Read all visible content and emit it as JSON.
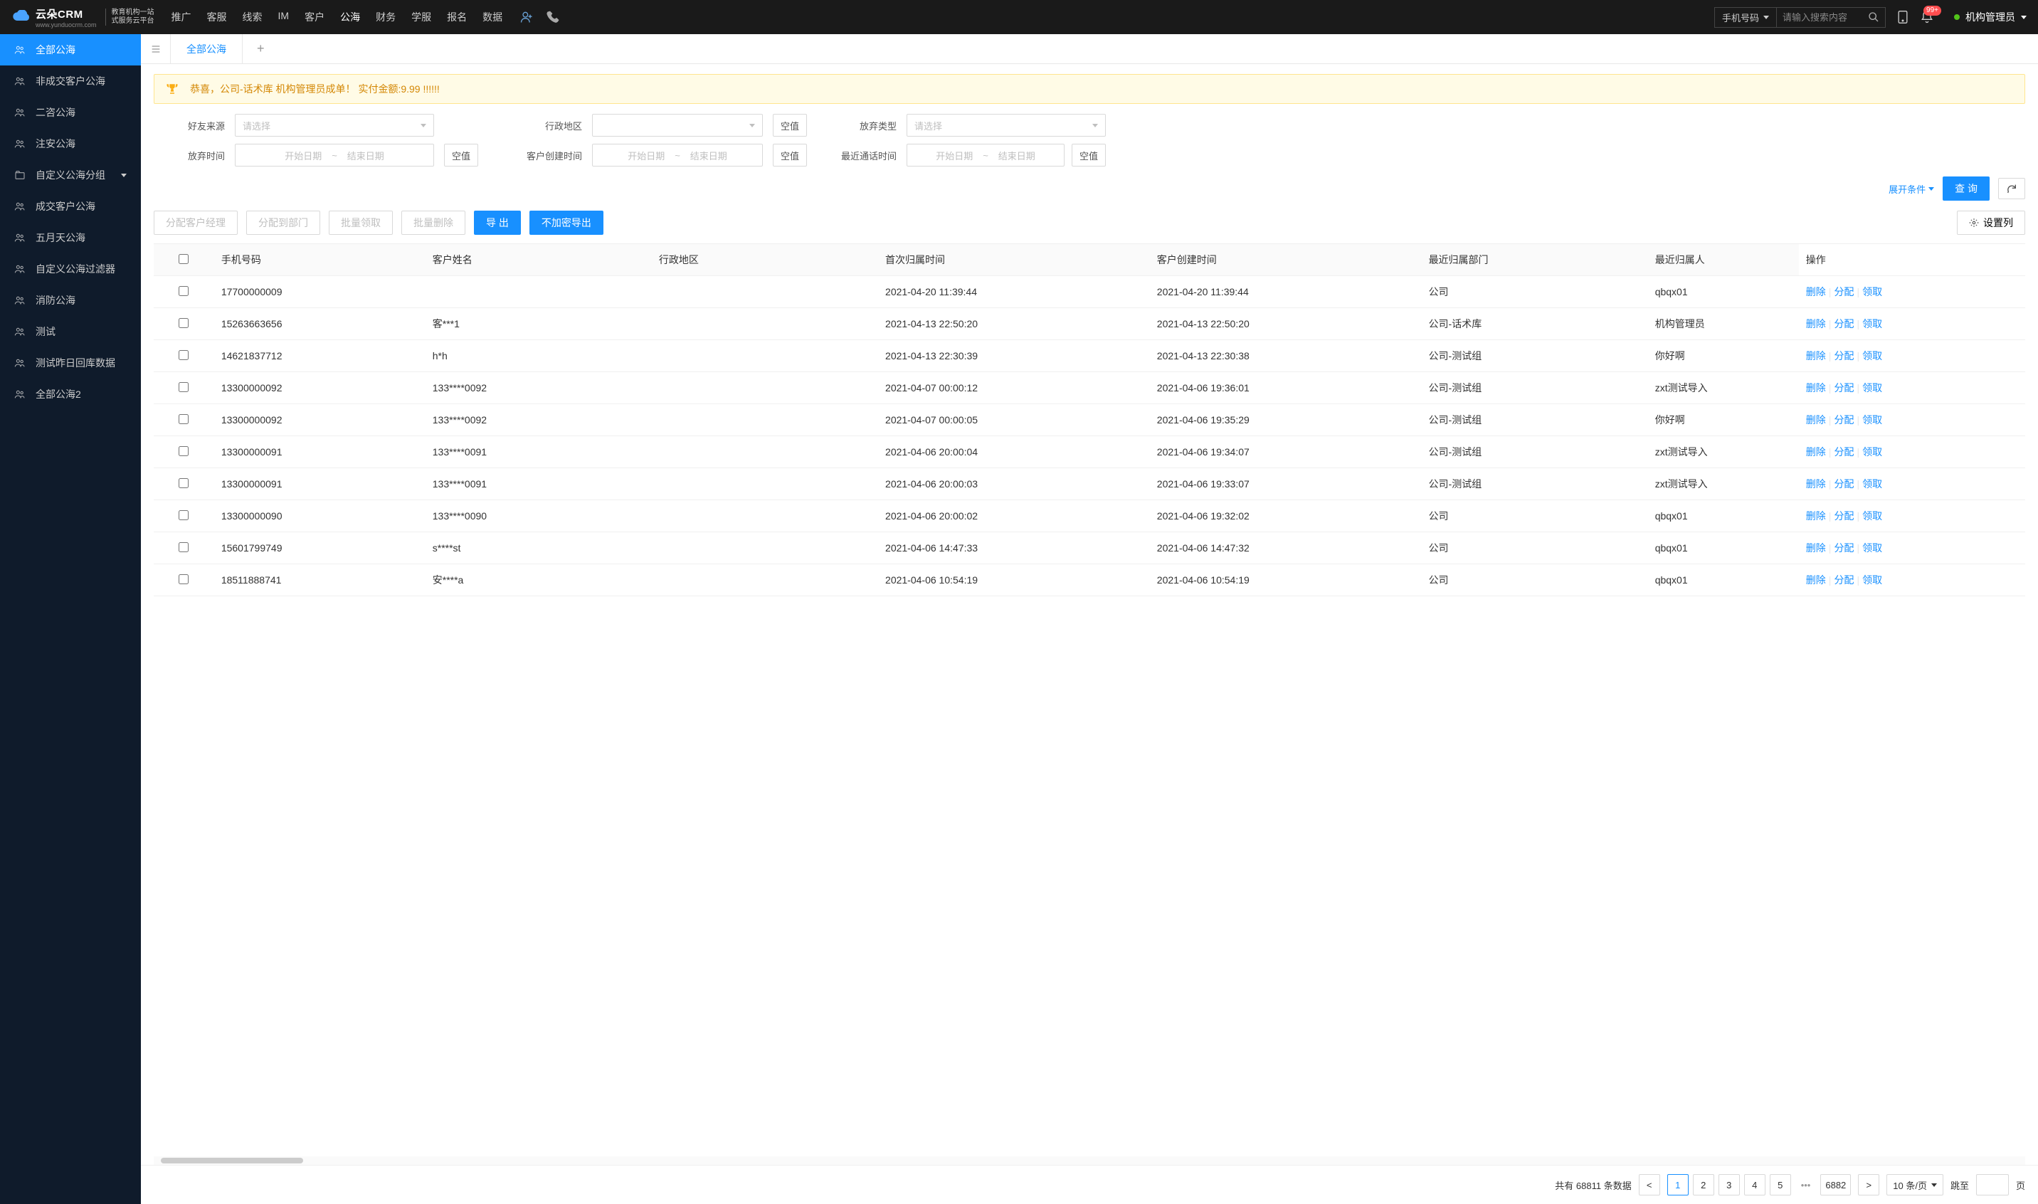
{
  "header": {
    "logo_main": "云朵CRM",
    "logo_url": "www.yunduocrm.com",
    "logo_sub1": "教育机构一站",
    "logo_sub2": "式服务云平台",
    "nav": [
      "推广",
      "客服",
      "线索",
      "IM",
      "客户",
      "公海",
      "财务",
      "学服",
      "报名",
      "数据"
    ],
    "nav_active": 5,
    "search_type": "手机号码",
    "search_placeholder": "请输入搜索内容",
    "notif_badge": "99+",
    "user_name": "机构管理员"
  },
  "sidebar": {
    "items": [
      {
        "label": "全部公海",
        "active": true,
        "icon": "users"
      },
      {
        "label": "非成交客户公海",
        "icon": "users"
      },
      {
        "label": "二咨公海",
        "icon": "users"
      },
      {
        "label": "注安公海",
        "icon": "users"
      },
      {
        "label": "自定义公海分组",
        "icon": "folder",
        "expandable": true
      },
      {
        "label": "成交客户公海",
        "icon": "users"
      },
      {
        "label": "五月天公海",
        "icon": "users"
      },
      {
        "label": "自定义公海过滤器",
        "icon": "users"
      },
      {
        "label": "消防公海",
        "icon": "users"
      },
      {
        "label": "测试",
        "icon": "users"
      },
      {
        "label": "测试昨日回库数据",
        "icon": "users"
      },
      {
        "label": "全部公海2",
        "icon": "users"
      }
    ]
  },
  "tabs": {
    "active_label": "全部公海"
  },
  "notice": "恭喜，公司-话术库  机构管理员成单！  实付金额:9.99 !!!!!!",
  "filters": {
    "friend_source": {
      "label": "好友来源",
      "placeholder": "请选择"
    },
    "admin_region": {
      "label": "行政地区",
      "placeholder": ""
    },
    "null_btn": "空值",
    "abandon_type": {
      "label": "放弃类型",
      "placeholder": "请选择"
    },
    "abandon_time": {
      "label": "放弃时间",
      "start": "开始日期",
      "end": "结束日期"
    },
    "create_time": {
      "label": "客户创建时间",
      "start": "开始日期",
      "end": "结束日期"
    },
    "last_call_time": {
      "label": "最近通话时间",
      "start": "开始日期",
      "end": "结束日期"
    },
    "expand": "展开条件",
    "query": "查 询"
  },
  "toolbar": {
    "assign_mgr": "分配客户经理",
    "assign_dept": "分配到部门",
    "batch_claim": "批量领取",
    "batch_delete": "批量删除",
    "export": "导 出",
    "export_plain": "不加密导出",
    "columns": "设置列"
  },
  "table": {
    "columns": [
      "手机号码",
      "客户姓名",
      "行政地区",
      "首次归属时间",
      "客户创建时间",
      "最近归属部门",
      "最近归属人",
      "操作"
    ],
    "ops": {
      "delete": "删除",
      "assign": "分配",
      "claim": "领取"
    },
    "rows": [
      {
        "phone": "17700000009",
        "name": "",
        "region": "",
        "first": "2021-04-20 11:39:44",
        "created": "2021-04-20 11:39:44",
        "dept": "公司",
        "person": "qbqx01"
      },
      {
        "phone": "15263663656",
        "name": "客***1",
        "region": "",
        "first": "2021-04-13 22:50:20",
        "created": "2021-04-13 22:50:20",
        "dept": "公司-话术库",
        "person": "机构管理员"
      },
      {
        "phone": "14621837712",
        "name": "h*h",
        "region": "",
        "first": "2021-04-13 22:30:39",
        "created": "2021-04-13 22:30:38",
        "dept": "公司-测试组",
        "person": "你好啊"
      },
      {
        "phone": "13300000092",
        "name": "133****0092",
        "region": "",
        "first": "2021-04-07 00:00:12",
        "created": "2021-04-06 19:36:01",
        "dept": "公司-测试组",
        "person": "zxt测试导入"
      },
      {
        "phone": "13300000092",
        "name": "133****0092",
        "region": "",
        "first": "2021-04-07 00:00:05",
        "created": "2021-04-06 19:35:29",
        "dept": "公司-测试组",
        "person": "你好啊"
      },
      {
        "phone": "13300000091",
        "name": "133****0091",
        "region": "",
        "first": "2021-04-06 20:00:04",
        "created": "2021-04-06 19:34:07",
        "dept": "公司-测试组",
        "person": "zxt测试导入"
      },
      {
        "phone": "13300000091",
        "name": "133****0091",
        "region": "",
        "first": "2021-04-06 20:00:03",
        "created": "2021-04-06 19:33:07",
        "dept": "公司-测试组",
        "person": "zxt测试导入"
      },
      {
        "phone": "13300000090",
        "name": "133****0090",
        "region": "",
        "first": "2021-04-06 20:00:02",
        "created": "2021-04-06 19:32:02",
        "dept": "公司",
        "person": "qbqx01"
      },
      {
        "phone": "15601799749",
        "name": "s****st",
        "region": "",
        "first": "2021-04-06 14:47:33",
        "created": "2021-04-06 14:47:32",
        "dept": "公司",
        "person": "qbqx01"
      },
      {
        "phone": "18511888741",
        "name": "安****a",
        "region": "",
        "first": "2021-04-06 10:54:19",
        "created": "2021-04-06 10:54:19",
        "dept": "公司",
        "person": "qbqx01"
      }
    ]
  },
  "pagination": {
    "total_prefix": "共有",
    "total": "68811",
    "total_suffix": "条数据",
    "pages": [
      "1",
      "2",
      "3",
      "4",
      "5"
    ],
    "last_page": "6882",
    "per_page": "10 条/页",
    "jump_label": "跳至",
    "jump_suffix": "页"
  }
}
